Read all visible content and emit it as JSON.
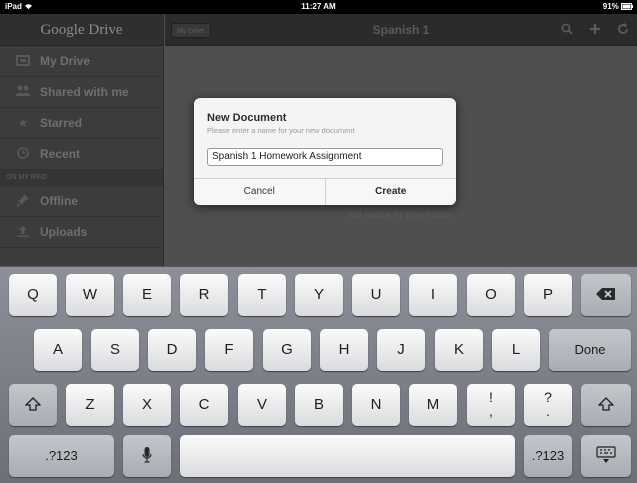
{
  "status_bar": {
    "device": "iPad",
    "wifi_icon": "wifi-icon",
    "time": "11:27 AM",
    "battery": "91%"
  },
  "app": {
    "brand": "Google Drive",
    "breadcrumb": "My Drive",
    "folder_title": "Spanish 1",
    "toolbar_icons": [
      "search-icon",
      "plus-icon",
      "refresh-icon"
    ],
    "sidebar": {
      "items": [
        {
          "label": "My Drive",
          "icon": "drive-icon"
        },
        {
          "label": "Shared with me",
          "icon": "people-icon"
        },
        {
          "label": "Starred",
          "icon": "star-icon"
        },
        {
          "label": "Recent",
          "icon": "clock-icon"
        }
      ],
      "section_label": "ON MY IPAD",
      "local_items": [
        {
          "label": "Offline",
          "icon": "pin-icon"
        },
        {
          "label": "Uploads",
          "icon": "upload-icon"
        }
      ]
    },
    "empty_message": "No items in this folder"
  },
  "dialog": {
    "title": "New Document",
    "subtitle": "Please enter a name for your new document",
    "input_value": "Spanish 1 Homework Assignment",
    "cancel_label": "Cancel",
    "create_label": "Create"
  },
  "keyboard": {
    "row1": [
      "Q",
      "W",
      "E",
      "R",
      "T",
      "Y",
      "U",
      "I",
      "O",
      "P"
    ],
    "row2": [
      "A",
      "S",
      "D",
      "F",
      "G",
      "H",
      "J",
      "K",
      "L"
    ],
    "row3": [
      "Z",
      "X",
      "C",
      "V",
      "B",
      "N",
      "M"
    ],
    "punct1_top": "!",
    "punct1_bottom": ",",
    "punct2_top": "?",
    "punct2_bottom": ".",
    "done_label": "Done",
    "numbers_label": ".?123",
    "shift_icon": "shift-icon",
    "backspace_icon": "backspace-icon",
    "mic_icon": "microphone-icon",
    "hide_icon": "keyboard-hide-icon"
  },
  "colors": {
    "app_dim": "#4f4f4f",
    "dialog_bg": "#f4f4f4",
    "keyboard_bg": "#7d8088"
  }
}
